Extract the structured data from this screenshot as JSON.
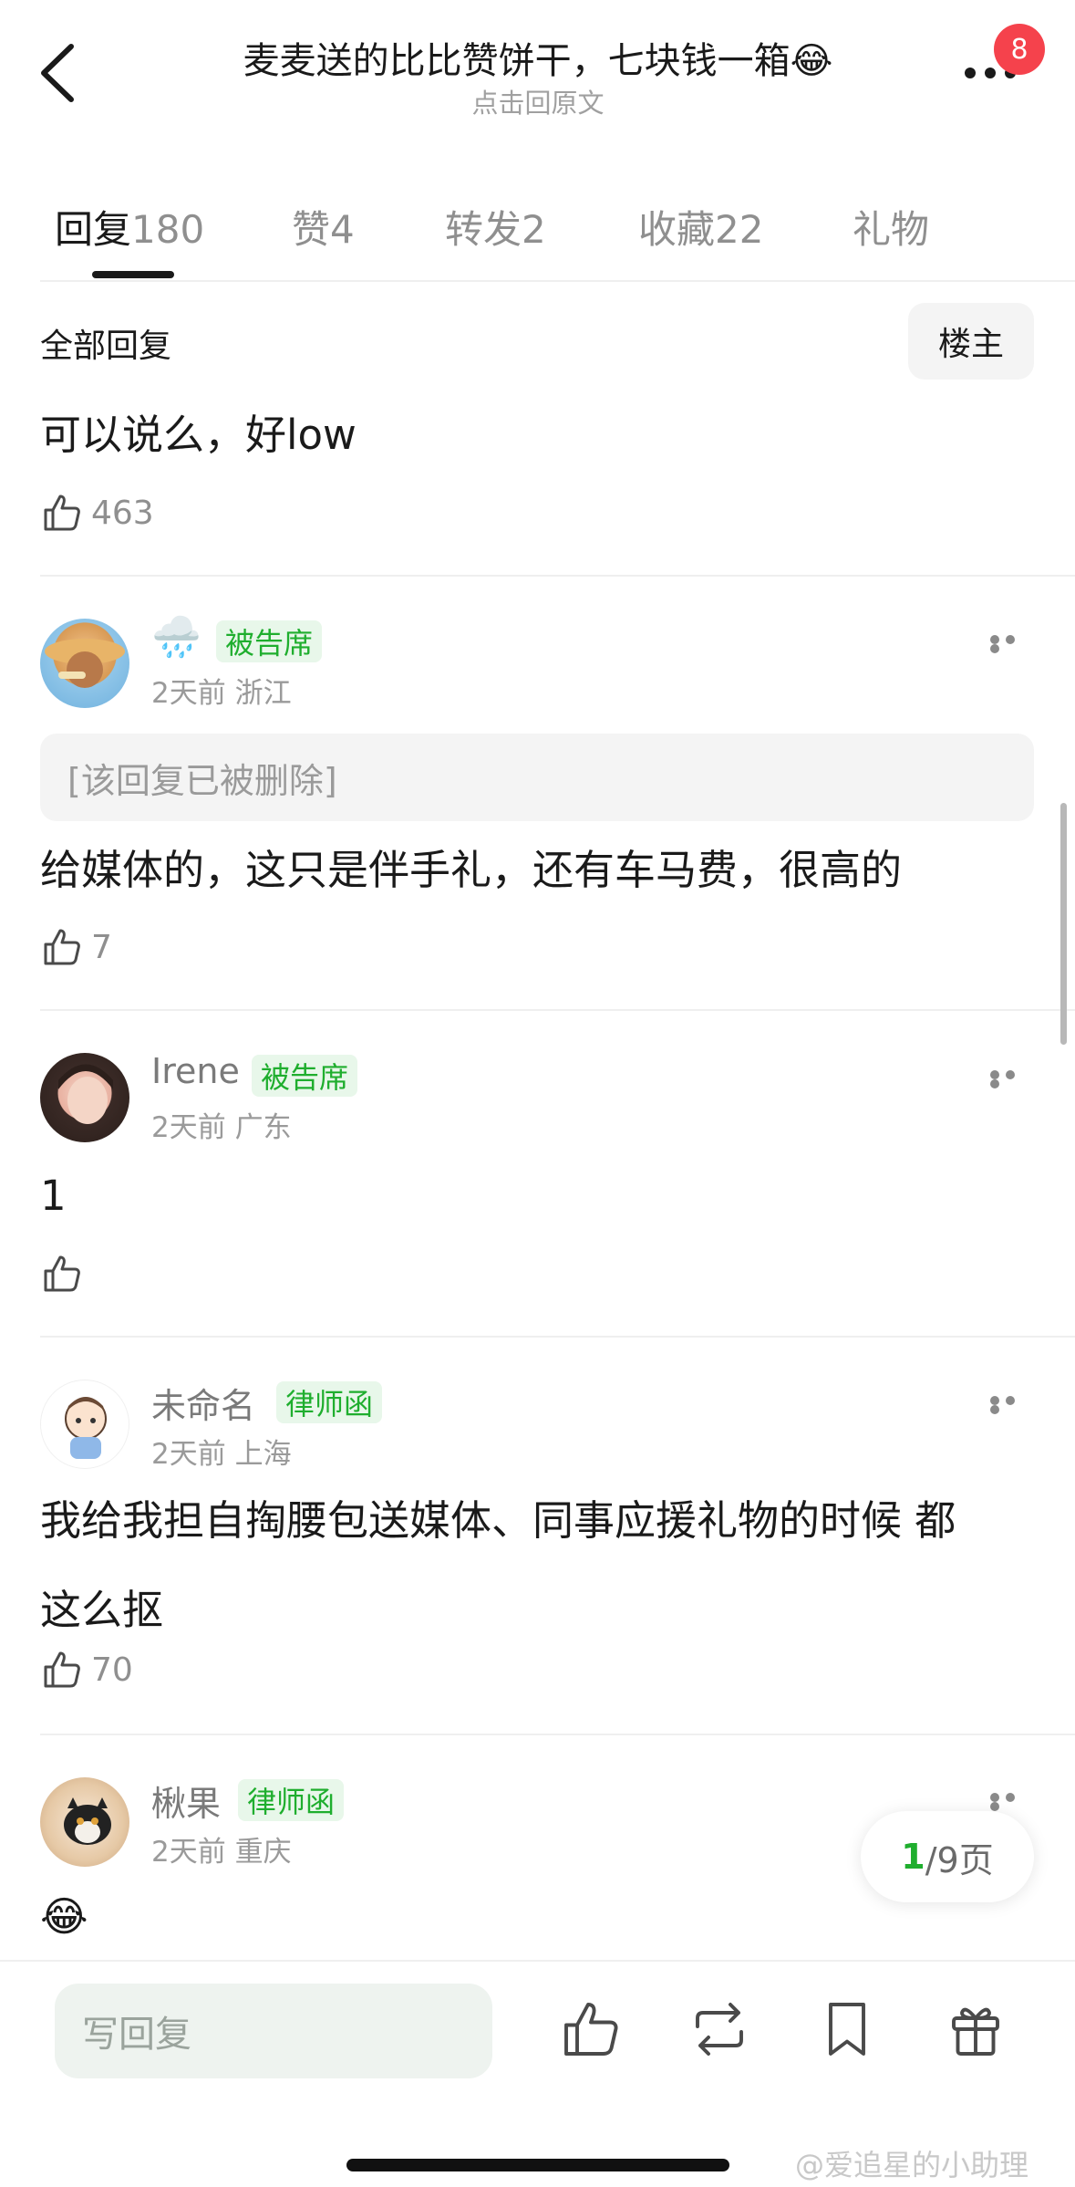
{
  "header": {
    "title": "麦麦送的比比赞饼干，七块钱一箱😂",
    "subtitle": "点击回原文",
    "badge_count": "8"
  },
  "tabs": [
    {
      "label": "回复",
      "count": "180"
    },
    {
      "label": "赞",
      "count": "4"
    },
    {
      "label": "转发",
      "count": "2"
    },
    {
      "label": "收藏",
      "count": "22"
    },
    {
      "label": "礼物",
      "count": ""
    }
  ],
  "section": {
    "title": "全部回复",
    "owner_button": "楼主"
  },
  "comments": [
    {
      "text": "可以说么，好low",
      "likes": "463"
    },
    {
      "name": "🌧️",
      "tag": "被告席",
      "time": "2天前",
      "location": "浙江",
      "quoted": "[该回复已被删除]",
      "text": "给媒体的，这只是伴手礼，还有车马费，很高的",
      "likes": "7"
    },
    {
      "name": "Irene",
      "tag": "被告席",
      "time": "2天前",
      "location": "广东",
      "text": "1",
      "likes": ""
    },
    {
      "name": "未命名",
      "tag": "律师函",
      "time": "2天前",
      "location": "上海",
      "text_line1": "我给我担自掏腰包送媒体、同事应援礼物的时候 都",
      "text_line2": "这么抠",
      "likes": "70"
    },
    {
      "name": "楸果",
      "tag": "律师函",
      "time": "2天前",
      "location": "重庆",
      "text": "😂"
    }
  ],
  "pager": {
    "current": "1",
    "total": "/9页"
  },
  "bottom_bar": {
    "reply_placeholder": "写回复"
  },
  "watermark": "@爱追星的小助理",
  "colors": {
    "accent_green": "#1fae2e",
    "tag_bg": "#e8f7ea",
    "badge_red": "#f5424c"
  }
}
